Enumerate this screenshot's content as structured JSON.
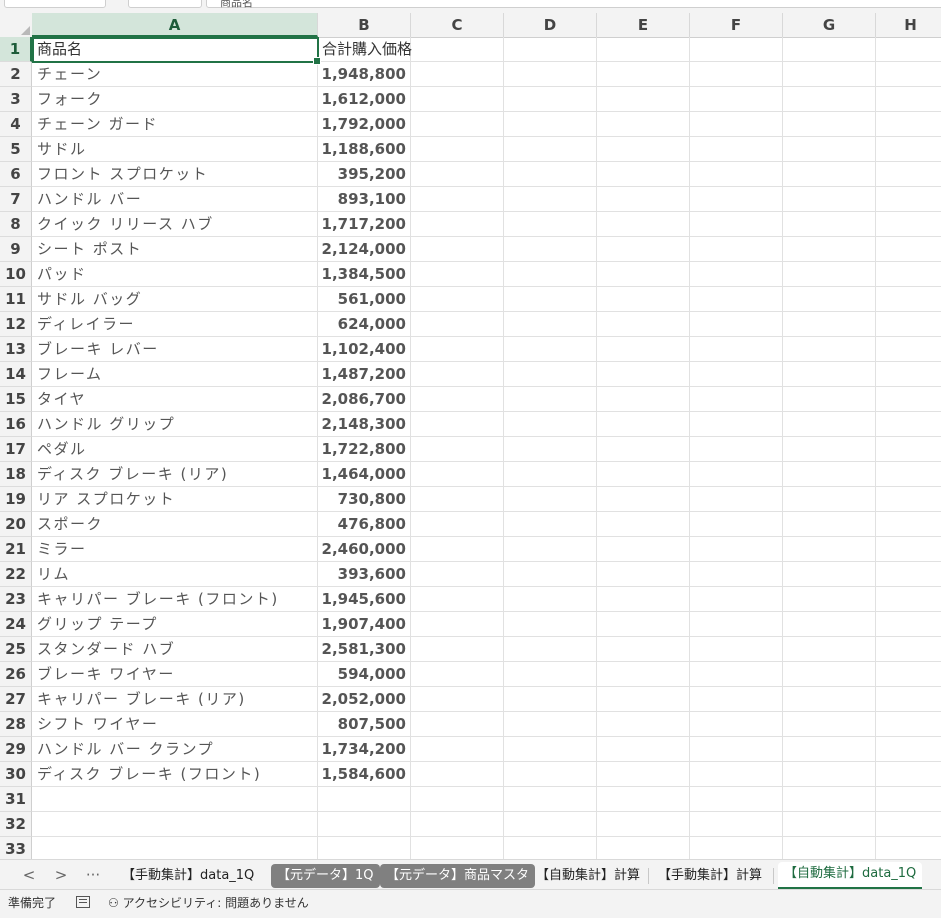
{
  "formula_bar": {
    "name_box": "",
    "formula_text": "商品名"
  },
  "columns": [
    "A",
    "B",
    "C",
    "D",
    "E",
    "F",
    "G",
    "H"
  ],
  "selected_column": "A",
  "rows": [
    {
      "n": "1",
      "a": "商品名",
      "b": "合計購入価格"
    },
    {
      "n": "2",
      "a": "チェーン",
      "b": "1,948,800"
    },
    {
      "n": "3",
      "a": "フォーク",
      "b": "1,612,000"
    },
    {
      "n": "4",
      "a": "チェーン ガード",
      "b": "1,792,000"
    },
    {
      "n": "5",
      "a": "サドル",
      "b": "1,188,600"
    },
    {
      "n": "6",
      "a": "フロント スプロケット",
      "b": "395,200"
    },
    {
      "n": "7",
      "a": "ハンドル バー",
      "b": "893,100"
    },
    {
      "n": "8",
      "a": "クイック リリース ハブ",
      "b": "1,717,200"
    },
    {
      "n": "9",
      "a": "シート ポスト",
      "b": "2,124,000"
    },
    {
      "n": "10",
      "a": "パッド",
      "b": "1,384,500"
    },
    {
      "n": "11",
      "a": "サドル バッグ",
      "b": "561,000"
    },
    {
      "n": "12",
      "a": "ディレイラー",
      "b": "624,000"
    },
    {
      "n": "13",
      "a": "ブレーキ レバー",
      "b": "1,102,400"
    },
    {
      "n": "14",
      "a": "フレーム",
      "b": "1,487,200"
    },
    {
      "n": "15",
      "a": "タイヤ",
      "b": "2,086,700"
    },
    {
      "n": "16",
      "a": "ハンドル グリップ",
      "b": "2,148,300"
    },
    {
      "n": "17",
      "a": "ペダル",
      "b": "1,722,800"
    },
    {
      "n": "18",
      "a": "ディスク ブレーキ (リア)",
      "b": "1,464,000"
    },
    {
      "n": "19",
      "a": "リア スプロケット",
      "b": "730,800"
    },
    {
      "n": "20",
      "a": "スポーク",
      "b": "476,800"
    },
    {
      "n": "21",
      "a": "ミラー",
      "b": "2,460,000"
    },
    {
      "n": "22",
      "a": "リム",
      "b": "393,600"
    },
    {
      "n": "23",
      "a": "キャリパー ブレーキ (フロント)",
      "b": "1,945,600"
    },
    {
      "n": "24",
      "a": "グリップ テープ",
      "b": "1,907,400"
    },
    {
      "n": "25",
      "a": "スタンダード ハブ",
      "b": "2,581,300"
    },
    {
      "n": "26",
      "a": "ブレーキ ワイヤー",
      "b": "594,000"
    },
    {
      "n": "27",
      "a": "キャリパー ブレーキ (リア)",
      "b": "2,052,000"
    },
    {
      "n": "28",
      "a": "シフト ワイヤー",
      "b": "807,500"
    },
    {
      "n": "29",
      "a": "ハンドル バー クランプ",
      "b": "1,734,200"
    },
    {
      "n": "30",
      "a": "ディスク ブレーキ (フロント)",
      "b": "1,584,600"
    },
    {
      "n": "31",
      "a": "",
      "b": ""
    },
    {
      "n": "32",
      "a": "",
      "b": ""
    },
    {
      "n": "33",
      "a": "",
      "b": ""
    }
  ],
  "sheet_nav": {
    "prev": "<",
    "next": ">",
    "more": "···"
  },
  "sheet_tabs": [
    {
      "label": "【手動集計】data_1Q",
      "style": "normal"
    },
    {
      "label": "【元データ】1Q",
      "style": "gray"
    },
    {
      "label": "【元データ】商品マスタ",
      "style": "gray"
    },
    {
      "label": "【自動集計】計算",
      "style": "normal"
    },
    {
      "label": "【手動集計】計算",
      "style": "normal"
    },
    {
      "label": "【自動集計】data_1Q",
      "style": "active"
    }
  ],
  "status": {
    "ready": "準備完了",
    "accessibility": "アクセシビリティ: 問題ありません"
  },
  "colors": {
    "accent": "#217346",
    "header_bg": "#f3f3f3",
    "tab_gray": "#808080"
  }
}
